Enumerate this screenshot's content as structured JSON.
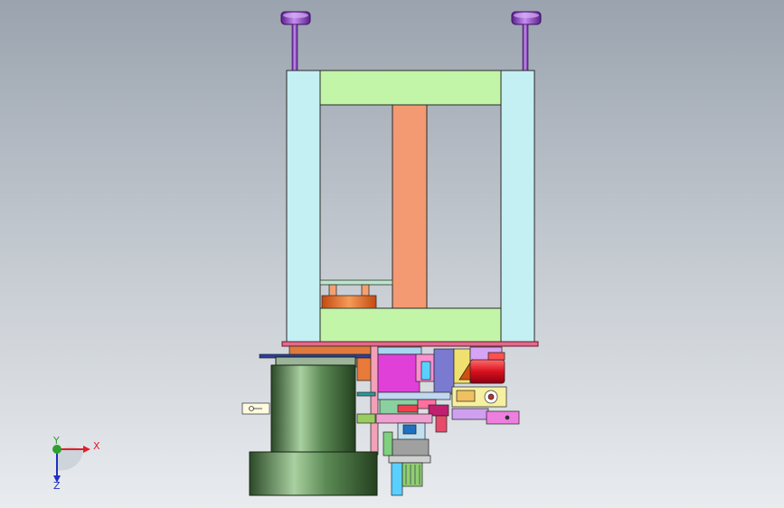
{
  "viewport": {
    "background_top": "#9aa3ae",
    "background_bottom": "#e9ecef"
  },
  "model": {
    "colors": {
      "frame_column": "#c4f0f3",
      "frame_beam": "#c2f5a8",
      "center_column": "#f39a72",
      "base_plate": "#e36a8b",
      "handle": "#8a3fc4",
      "motor": "#3f6b3a",
      "bracket_magenta": "#e040d8",
      "cylinder_red": "#e5283a",
      "bracket_pink": "#ef7fdf"
    },
    "icons": [
      "handle-knob-icon",
      "handle-knob-icon",
      "key-tag-icon"
    ]
  },
  "triad": {
    "x_label": "X",
    "y_label": "Y",
    "z_label": "Z",
    "x_color": "#e0202a",
    "y_color": "#2ea02e",
    "z_color": "#2030c0"
  }
}
